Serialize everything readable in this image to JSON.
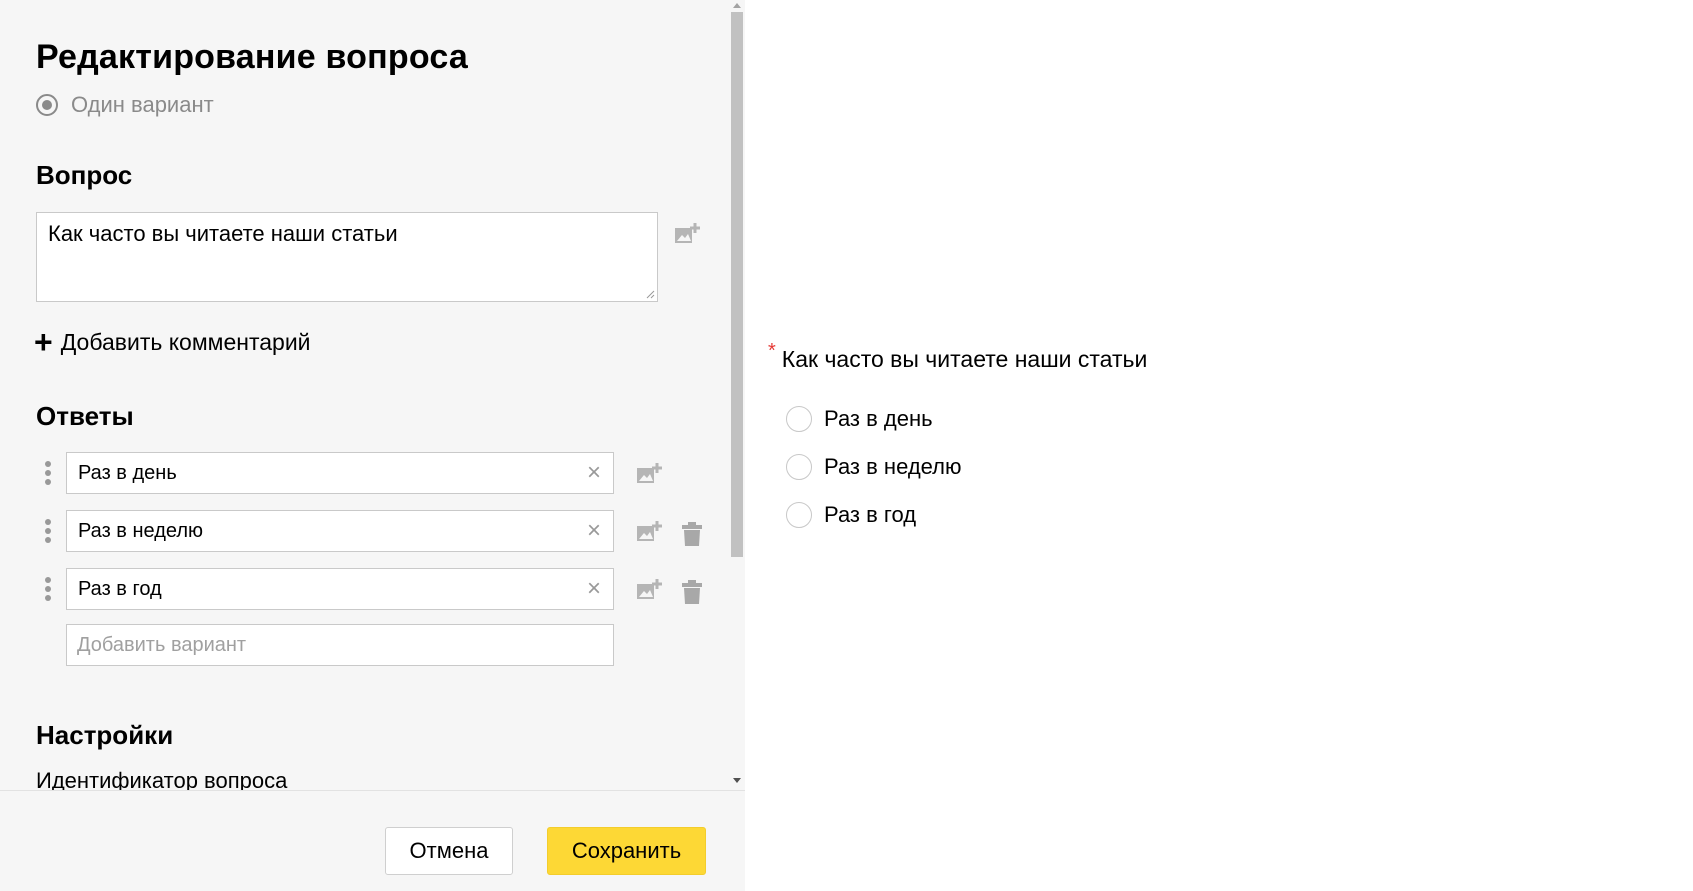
{
  "editor": {
    "title": "Редактирование вопроса",
    "question_type": "Один вариант",
    "question_section": "Вопрос",
    "question_text": "Как часто вы читаете наши статьи",
    "add_comment": "Добавить комментарий",
    "answers_section": "Ответы",
    "answers": [
      {
        "label": "Раз в день"
      },
      {
        "label": "Раз в неделю"
      },
      {
        "label": "Раз в год"
      }
    ],
    "add_variant_placeholder": "Добавить вариант",
    "settings_section": "Настройки",
    "settings_first_label": "Идентификатор вопроса"
  },
  "footer": {
    "cancel_label": "Отмена",
    "save_label": "Сохранить"
  },
  "preview": {
    "required_mark": "*",
    "question": "Как часто вы читаете наши статьи",
    "options": [
      "Раз в день",
      "Раз в неделю",
      "Раз в год"
    ]
  },
  "colors": {
    "panel_bg": "#f6f6f6",
    "save_button": "#fdd835",
    "required": "#e53935"
  }
}
